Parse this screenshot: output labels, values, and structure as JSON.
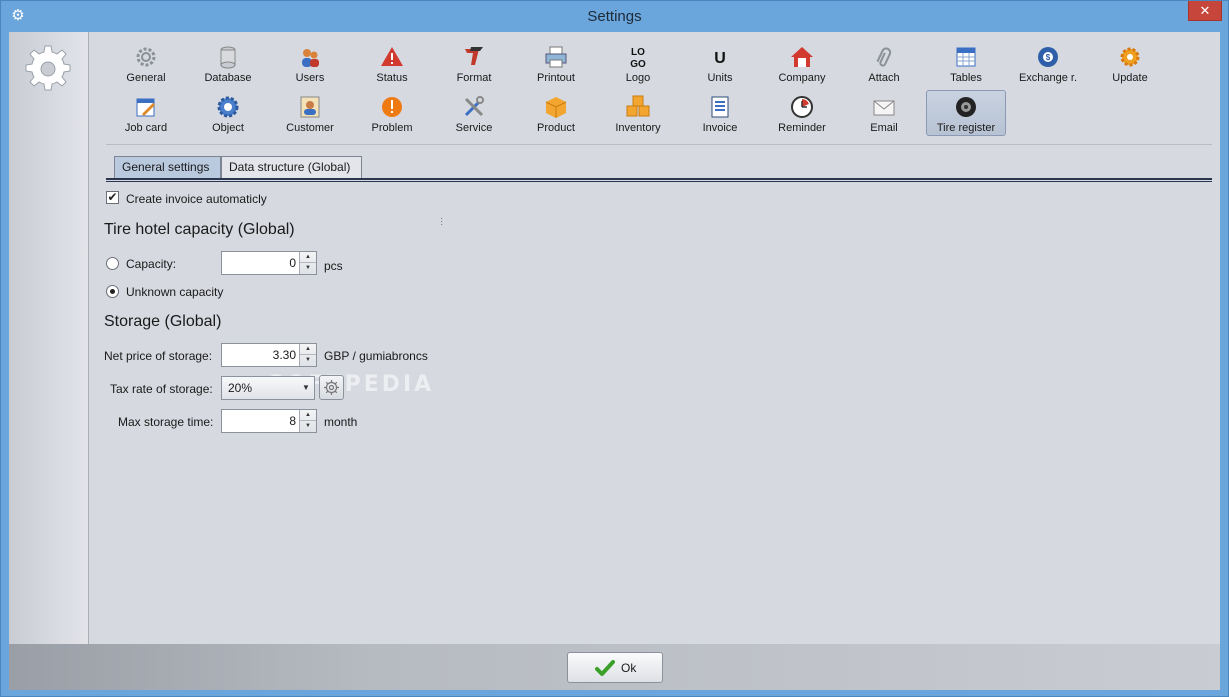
{
  "window": {
    "title": "Settings",
    "close_glyph": "✕",
    "app_icon": "gear-icon"
  },
  "toolbar": {
    "row1": [
      {
        "label": "General",
        "icon": "gear-icon"
      },
      {
        "label": "Database",
        "icon": "database-icon"
      },
      {
        "label": "Users",
        "icon": "users-icon"
      },
      {
        "label": "Status",
        "icon": "warning-triangle-icon"
      },
      {
        "label": "Format",
        "icon": "format-icon"
      },
      {
        "label": "Printout",
        "icon": "printer-icon"
      },
      {
        "label": "Logo",
        "icon": "logo-icon",
        "text": "LO\nGO"
      },
      {
        "label": "Units",
        "icon": "units-icon",
        "text": "U"
      },
      {
        "label": "Company",
        "icon": "house-icon"
      },
      {
        "label": "Attach",
        "icon": "paperclip-icon"
      },
      {
        "label": "Tables",
        "icon": "table-icon"
      },
      {
        "label": "Exchange r.",
        "icon": "exchange-icon"
      },
      {
        "label": "Update",
        "icon": "update-icon"
      }
    ],
    "row2": [
      {
        "label": "Job card",
        "icon": "job-card-icon"
      },
      {
        "label": "Object",
        "icon": "object-gear-icon"
      },
      {
        "label": "Customer",
        "icon": "customer-icon"
      },
      {
        "label": "Problem",
        "icon": "problem-icon"
      },
      {
        "label": "Service",
        "icon": "tools-icon"
      },
      {
        "label": "Product",
        "icon": "box-icon"
      },
      {
        "label": "Inventory",
        "icon": "boxes-icon"
      },
      {
        "label": "Invoice",
        "icon": "invoice-icon"
      },
      {
        "label": "Reminder",
        "icon": "clock-icon"
      },
      {
        "label": "Email",
        "icon": "email-icon"
      },
      {
        "label": "Tire register",
        "icon": "tire-icon",
        "active": true
      }
    ]
  },
  "tabs": [
    {
      "label": "General settings",
      "active": true
    },
    {
      "label": "Data structure (Global)",
      "active": false
    }
  ],
  "form": {
    "create_invoice": {
      "label": "Create invoice automaticly",
      "checked": true,
      "glyph": "✔"
    },
    "capacity_section": "Tire hotel capacity (Global)",
    "capacity": {
      "label": "Capacity:",
      "value": "0",
      "unit": "pcs",
      "selected": false
    },
    "unknown_capacity": {
      "label": "Unknown capacity",
      "selected": true
    },
    "storage_section": "Storage (Global)",
    "net_price": {
      "label": "Net price of storage:",
      "value": "3.30",
      "unit": "GBP / gumiabroncs"
    },
    "tax_rate": {
      "label": "Tax rate of storage:",
      "value": "20%"
    },
    "max_storage": {
      "label": "Max storage time:",
      "value": "8",
      "unit": "month"
    },
    "spinner_up": "▲",
    "spinner_down": "▼",
    "combo_arrow": "▼"
  },
  "watermark": "SOFTPEDIA",
  "ok_button": {
    "label": "Ok"
  },
  "colors": {
    "titlebar": "#6aa6dc",
    "client_bg": "#d6d9e0",
    "close_button": "#c7463c",
    "active_tab": "#b9c9de",
    "ok_check": "#3aa02a"
  }
}
